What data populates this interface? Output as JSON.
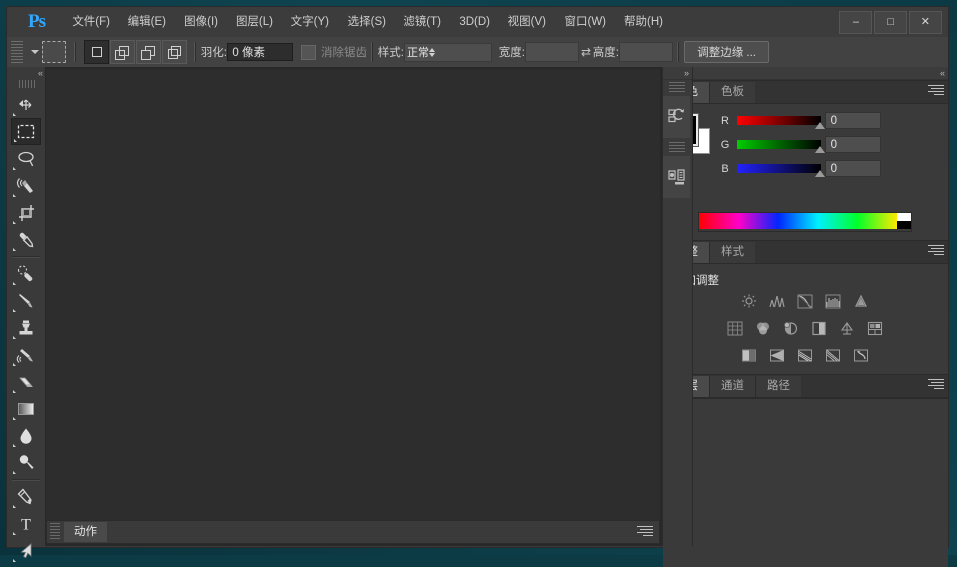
{
  "app": {
    "logo": "Ps",
    "accent_blue": "#31a8ff",
    "chrome_bg": "#3a3a3a",
    "desktop_bg": "#0d3b45",
    "note": "horizontally mirrored Adobe Photoshop CS6 window, Simplified Chinese UI"
  },
  "window_controls": {
    "close": "✕",
    "maximize": "□",
    "minimize": "–"
  },
  "menubar": {
    "items": [
      {
        "label": "文件(F)",
        "name": "menu-file"
      },
      {
        "label": "编辑(E)",
        "name": "menu-edit"
      },
      {
        "label": "图像(I)",
        "name": "menu-image"
      },
      {
        "label": "图层(L)",
        "name": "menu-layer"
      },
      {
        "label": "文字(Y)",
        "name": "menu-type"
      },
      {
        "label": "选择(S)",
        "name": "menu-select"
      },
      {
        "label": "滤镜(T)",
        "name": "menu-filter"
      },
      {
        "label": "3D(D)",
        "name": "menu-3d"
      },
      {
        "label": "视图(V)",
        "name": "menu-view"
      },
      {
        "label": "窗口(W)",
        "name": "menu-window"
      },
      {
        "label": "帮助(H)",
        "name": "menu-help"
      }
    ]
  },
  "options_bar": {
    "tool_preset_label": "tool-preset-picker",
    "selection_modes": [
      {
        "name": "new-selection",
        "active": true
      },
      {
        "name": "add-to-selection",
        "active": false
      },
      {
        "name": "subtract-from-selection",
        "active": false
      },
      {
        "name": "intersect-selection",
        "active": false
      }
    ],
    "feather_label": "羽化:",
    "feather_value": "0 像素",
    "antialias_label": "消除锯齿",
    "antialias_checked": false,
    "style_label": "样式:",
    "style_value": "正常",
    "width_label": "宽度:",
    "width_value": "",
    "link_icon": "⇄",
    "height_label": "高度:",
    "height_value": "",
    "refine_edge_label": "调整边缘 ..."
  },
  "panels": {
    "color": {
      "tabs": [
        {
          "label": "颜色",
          "active": true,
          "name": "tab-color"
        },
        {
          "label": "色板",
          "active": false,
          "name": "tab-swatches"
        }
      ],
      "channels": [
        {
          "letter": "R",
          "value": "0",
          "from": "#ff0000",
          "to": "#000000"
        },
        {
          "letter": "G",
          "value": "0",
          "from": "#00cc00",
          "to": "#000000"
        },
        {
          "letter": "B",
          "value": "0",
          "from": "#0000ff",
          "to": "#000000"
        }
      ],
      "foreground_color": "#000000",
      "background_color": "#ffffff"
    },
    "adjustments": {
      "tabs": [
        {
          "label": "调整",
          "active": true,
          "name": "tab-adjustments"
        },
        {
          "label": "样式",
          "active": false,
          "name": "tab-styles"
        }
      ],
      "title": "添加调整",
      "rows": [
        [
          "brightness-contrast-icon",
          "levels-icon",
          "curves-icon",
          "exposure-icon",
          "vibrance-icon"
        ],
        [
          "hue-saturation-icon",
          "color-balance-icon",
          "black-white-icon",
          "photo-filter-icon",
          "channel-mixer-icon",
          "color-lookup-icon"
        ],
        [
          "invert-icon",
          "posterize-icon",
          "threshold-icon",
          "gradient-map-icon",
          "selective-color-icon"
        ]
      ]
    },
    "layers": {
      "tabs": [
        {
          "label": "图层",
          "active": true,
          "name": "tab-layers"
        },
        {
          "label": "通道",
          "active": false,
          "name": "tab-channels"
        },
        {
          "label": "路径",
          "active": false,
          "name": "tab-paths"
        }
      ]
    },
    "icon_dock": [
      {
        "name": "history-panel-icon"
      },
      {
        "name": "properties-panel-icon"
      }
    ],
    "actions": {
      "tab_label": "动作"
    }
  },
  "toolbox": {
    "tools": [
      {
        "name": "move-tool",
        "active": false,
        "has_submenu": true
      },
      {
        "name": "rectangular-marquee-tool",
        "active": true,
        "has_submenu": true
      },
      {
        "name": "lasso-tool",
        "active": false,
        "has_submenu": true
      },
      {
        "name": "quick-selection-tool",
        "active": false,
        "has_submenu": true
      },
      {
        "name": "crop-tool",
        "active": false,
        "has_submenu": true
      },
      {
        "name": "eyedropper-tool",
        "active": false,
        "has_submenu": true
      },
      {
        "name": "spot-healing-brush-tool",
        "active": false,
        "has_submenu": true
      },
      {
        "name": "brush-tool",
        "active": false,
        "has_submenu": true
      },
      {
        "name": "clone-stamp-tool",
        "active": false,
        "has_submenu": true
      },
      {
        "name": "history-brush-tool",
        "active": false,
        "has_submenu": true
      },
      {
        "name": "eraser-tool",
        "active": false,
        "has_submenu": true
      },
      {
        "name": "gradient-tool",
        "active": false,
        "has_submenu": true
      },
      {
        "name": "blur-tool",
        "active": false,
        "has_submenu": true
      },
      {
        "name": "dodge-tool",
        "active": false,
        "has_submenu": true
      },
      {
        "name": "pen-tool",
        "active": false,
        "has_submenu": true
      },
      {
        "name": "horizontal-type-tool",
        "active": false,
        "has_submenu": true
      },
      {
        "name": "path-selection-tool",
        "active": false,
        "has_submenu": true
      }
    ]
  }
}
